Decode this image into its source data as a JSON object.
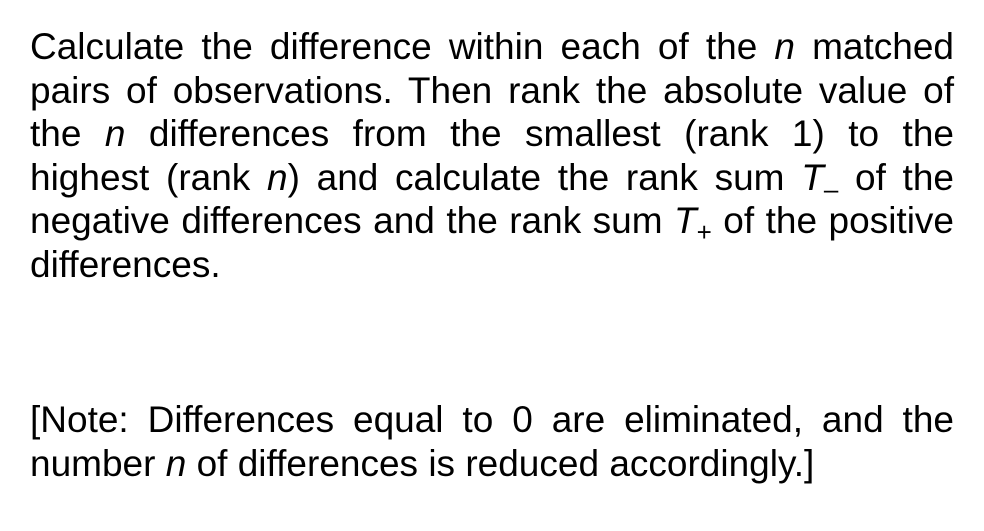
{
  "procedure": {
    "s1": "Calculate the difference within each of the ",
    "var_n": "n",
    "s2": " matched pairs of observations. Then rank the absolute value of the ",
    "s3": " differences from the smallest (rank 1) to the highest (rank ",
    "s4": ") and calculate the rank sum ",
    "var_T": "T",
    "sub_minus": "–",
    "s5": " of the negative differences and the rank sum ",
    "sub_plus": "+",
    "s6": " of the positive differences."
  },
  "note": {
    "s1": "[Note: Differences equal to 0 are eliminated, and the number ",
    "var_n": "n",
    "s2": " of differences is reduced accordingly.]"
  }
}
